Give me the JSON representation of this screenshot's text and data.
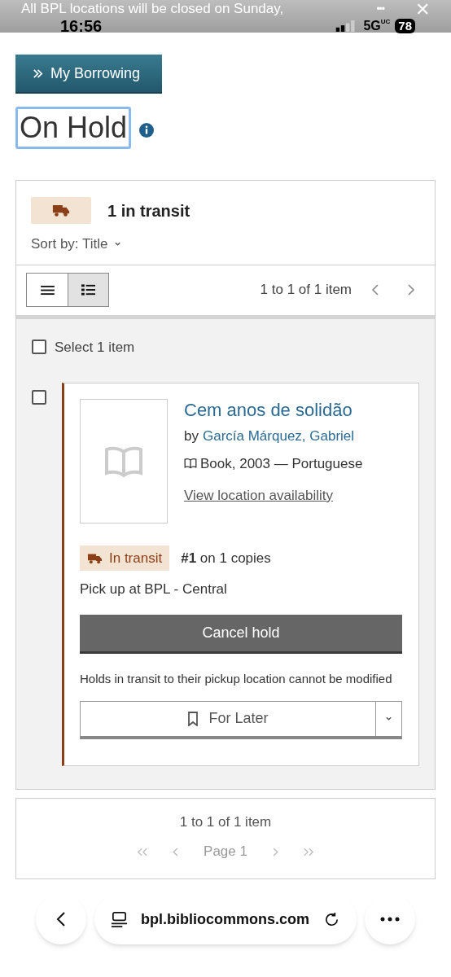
{
  "banner": {
    "text": "All BPL locations will be closed on Sunday,",
    "more": "•••",
    "close": "✕"
  },
  "status_bar": {
    "time": "16:56",
    "network": "5G",
    "network_sup": "UC",
    "battery": "78"
  },
  "back_button": {
    "label": "My Borrowing"
  },
  "heading": {
    "title": "On Hold"
  },
  "summary": {
    "count_label": "1 in transit",
    "sort_label": "Sort by: Title"
  },
  "view_toggle": [
    {
      "kind": "compact",
      "selected": false
    },
    {
      "kind": "detailed",
      "selected": true
    }
  ],
  "pagination_top": {
    "range": "1 to 1 of 1 item"
  },
  "select_all": {
    "label": "Select 1 item",
    "checked": false
  },
  "holds": [
    {
      "checked": false,
      "title": "Cem anos de solidão",
      "by": "by",
      "author": "García Márquez, Gabriel",
      "format": "Book, 2003 — Portuguese",
      "availability_link": "View location availability",
      "status": "In transit",
      "position": "#1",
      "position_rest": "on 1 copies",
      "pickup": "Pick up at BPL - Central",
      "cancel_button": "Cancel hold",
      "note": "Holds in transit to their pickup location cannot be modified",
      "shelf_button": "For Later"
    }
  ],
  "pagination_bottom": {
    "range": "1 to 1 of 1 item",
    "page_label": "Page 1"
  },
  "browser_bar": {
    "url": "bpl.bibliocommons.com"
  }
}
